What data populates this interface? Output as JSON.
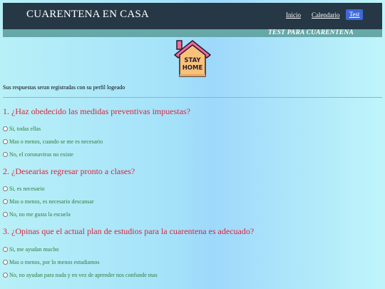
{
  "header": {
    "brand": "CUARENTENA EN CASA",
    "nav": {
      "inicio": "Inicio",
      "calendario": "Calendario",
      "test": "Test"
    },
    "subtitle": "TEST PARA CUARENTENA"
  },
  "logo": {
    "line1": "STAY",
    "line2": "HOME",
    "icon": "stay-home-house-icon"
  },
  "intro": "Sus respuestas seran registradas con su perfil logeado",
  "questions": [
    {
      "text": "1. ¿Haz obedecido las medidas preventivas impuestas?",
      "options": [
        "Si, todas ellas",
        "Mas o menos, cuando se me es necesario",
        "No, el coronavirus no existe"
      ]
    },
    {
      "text": "2. ¿Desearias regresar pronto a clases?",
      "options": [
        "Si, es necesario",
        "Mas o menos, es necesario descansar",
        "No, no me gusta la escuela"
      ]
    },
    {
      "text": "3. ¿Opinas que el actual plan de estudios para la cuarentena es adecuado?",
      "options": [
        "Si, me ayudan mucho",
        "Mas o menos, por lo menos estudiamos",
        "No, no ayudan para nada y en vez de aprender nos confunde mas"
      ]
    }
  ],
  "colors": {
    "navbar": "#263845",
    "subbar": "#66a8a8",
    "active_nav": "#3d68d8",
    "question": "#d7263d",
    "option": "#2f7d3a",
    "roof": "#f06b9e",
    "house_body": "#f8c27a"
  }
}
